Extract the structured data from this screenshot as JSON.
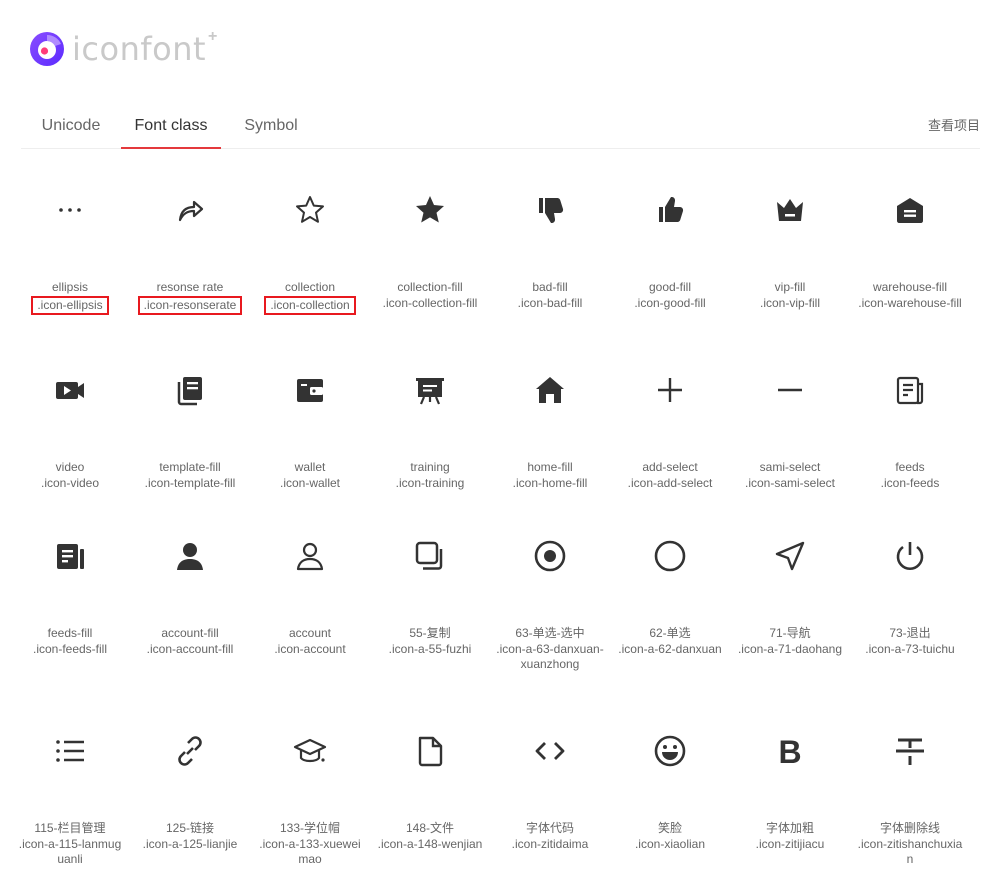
{
  "brand": {
    "name": "iconfont",
    "plus": "+"
  },
  "tabs": [
    {
      "label": "Unicode",
      "active": false
    },
    {
      "label": "Font class",
      "active": true
    },
    {
      "label": "Symbol",
      "active": false
    }
  ],
  "header": {
    "view_project_label": "查看项目"
  },
  "accent_color": "#e4393c",
  "icons": [
    {
      "name": "ellipsis",
      "cls": ".icon-ellipsis",
      "icon": "ellipsis-icon",
      "highlight": true
    },
    {
      "name": "resonse rate",
      "cls": ".icon-resonserate",
      "icon": "share-arrow-icon",
      "highlight": true
    },
    {
      "name": "collection",
      "cls": ".icon-collection",
      "icon": "star-outline-icon",
      "highlight": true
    },
    {
      "name": "collection-fill",
      "cls": ".icon-collection-fill",
      "icon": "star-fill-icon"
    },
    {
      "name": "bad-fill",
      "cls": ".icon-bad-fill",
      "icon": "thumbs-down-icon"
    },
    {
      "name": "good-fill",
      "cls": ".icon-good-fill",
      "icon": "thumbs-up-icon"
    },
    {
      "name": "vip-fill",
      "cls": ".icon-vip-fill",
      "icon": "crown-icon"
    },
    {
      "name": "warehouse-fill",
      "cls": ".icon-warehouse-fill",
      "icon": "warehouse-icon"
    },
    {
      "name": "video",
      "cls": ".icon-video",
      "icon": "video-icon"
    },
    {
      "name": "template-fill",
      "cls": ".icon-template-fill",
      "icon": "template-icon"
    },
    {
      "name": "wallet",
      "cls": ".icon-wallet",
      "icon": "wallet-icon"
    },
    {
      "name": "training",
      "cls": ".icon-training",
      "icon": "training-board-icon"
    },
    {
      "name": "home-fill",
      "cls": ".icon-home-fill",
      "icon": "home-icon"
    },
    {
      "name": "add-select",
      "cls": ".icon-add-select",
      "icon": "plus-icon"
    },
    {
      "name": "sami-select",
      "cls": ".icon-sami-select",
      "icon": "minus-icon"
    },
    {
      "name": "feeds",
      "cls": ".icon-feeds",
      "icon": "feeds-outline-icon"
    },
    {
      "name": "feeds-fill",
      "cls": ".icon-feeds-fill",
      "icon": "feeds-fill-icon"
    },
    {
      "name": "account-fill",
      "cls": ".icon-account-fill",
      "icon": "account-fill-icon"
    },
    {
      "name": "account",
      "cls": ".icon-account",
      "icon": "account-outline-icon"
    },
    {
      "name": "55-复制",
      "cls": ".icon-a-55-fuzhi",
      "icon": "copy-icon"
    },
    {
      "name": "63-单选-选中",
      "cls": ".icon-a-63-danxuan-xuanzhong",
      "icon": "radio-checked-icon"
    },
    {
      "name": "62-单选",
      "cls": ".icon-a-62-danxuan",
      "icon": "radio-icon"
    },
    {
      "name": "71-导航",
      "cls": ".icon-a-71-daohang",
      "icon": "navigation-icon"
    },
    {
      "name": "73-退出",
      "cls": ".icon-a-73-tuichu",
      "icon": "power-icon"
    },
    {
      "name": "115-栏目管理",
      "cls": ".icon-a-115-lanmuguanli",
      "icon": "list-icon"
    },
    {
      "name": "125-链接",
      "cls": ".icon-a-125-lianjie",
      "icon": "link-icon"
    },
    {
      "name": "133-学位帽",
      "cls": ".icon-a-133-xueweimao",
      "icon": "graduation-cap-icon"
    },
    {
      "name": "148-文件",
      "cls": ".icon-a-148-wenjian",
      "icon": "file-icon"
    },
    {
      "name": "字体代码",
      "cls": ".icon-zitidaima",
      "icon": "code-icon"
    },
    {
      "name": "笑脸",
      "cls": ".icon-xiaolian",
      "icon": "smile-icon"
    },
    {
      "name": "字体加粗",
      "cls": ".icon-zitijiacu",
      "icon": "bold-icon"
    },
    {
      "name": "字体删除线",
      "cls": ".icon-zitishanchuxian",
      "icon": "strikethrough-icon"
    }
  ]
}
